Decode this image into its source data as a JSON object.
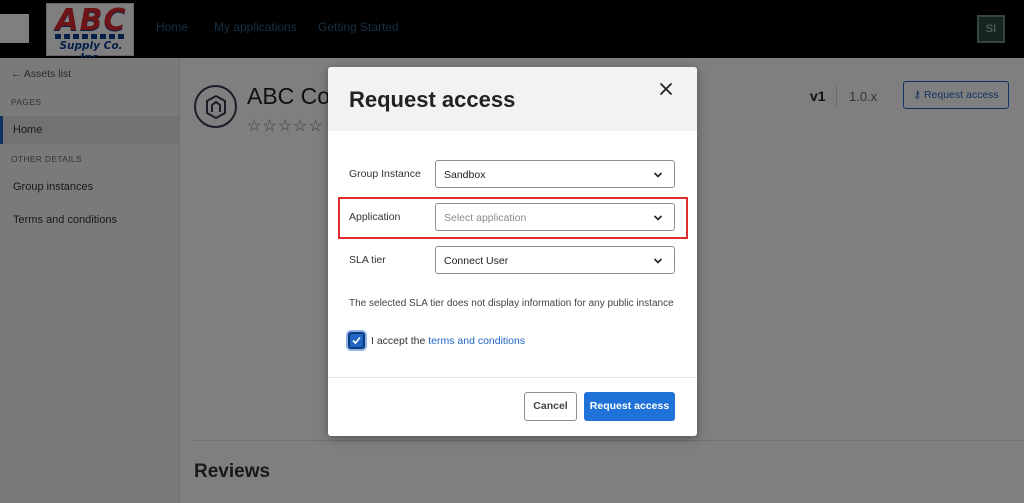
{
  "topbar": {
    "logo_text": "ABC",
    "logo_sub": "Supply Co. Inc.",
    "nav": [
      "Home",
      "My applications",
      "Getting Started"
    ],
    "avatar_initials": "SI"
  },
  "sidebar": {
    "back_label": "Assets list",
    "pages_label": "PAGES",
    "home_label": "Home",
    "other_label": "OTHER DETAILS",
    "items": [
      "Group instances",
      "Terms and conditions"
    ]
  },
  "asset": {
    "title": "ABC Cor",
    "stars": "☆☆☆☆☆",
    "version": "v1",
    "version_alt": "1.0.x",
    "request_label": "Request access",
    "reviews_label": "Reviews"
  },
  "modal": {
    "title": "Request access",
    "fields": {
      "group_instance": {
        "label": "Group Instance",
        "value": "Sandbox"
      },
      "application": {
        "label": "Application",
        "placeholder": "Select application"
      },
      "sla_tier": {
        "label": "SLA tier",
        "value": "Connect User"
      }
    },
    "info": "The selected SLA tier does not display information for any public instance",
    "accept_prefix": "I accept the",
    "accept_link": "terms and conditions",
    "accept_checked": true,
    "cancel_label": "Cancel",
    "submit_label": "Request access"
  },
  "colors": {
    "accent": "#1f72d8",
    "highlight": "#e02d2d",
    "topbar": "#000000"
  }
}
